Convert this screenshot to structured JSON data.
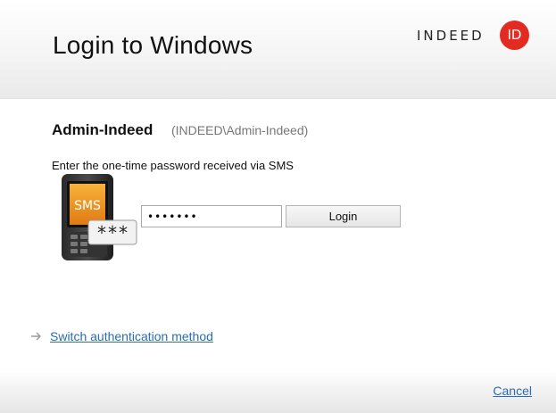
{
  "header": {
    "title": "Login to Windows",
    "logo_text": "INDEED",
    "logo_badge": "ID",
    "logo_color": "#e32b22"
  },
  "user": {
    "name": "Admin-Indeed",
    "domain": "(INDEED\\Admin-Indeed)"
  },
  "auth": {
    "prompt": "Enter the one-time password received via SMS",
    "phone_screen_label": "SMS",
    "phone_bubble_label": "***",
    "password_value": "1234567",
    "login_label": "Login"
  },
  "links": {
    "switch_method": "Switch authentication method",
    "cancel": "Cancel",
    "link_color": "#2a6db0"
  },
  "icons": {
    "logo": "indeed-id-logo",
    "phone": "sms-phone-icon",
    "arrow": "arrow-right-icon"
  }
}
